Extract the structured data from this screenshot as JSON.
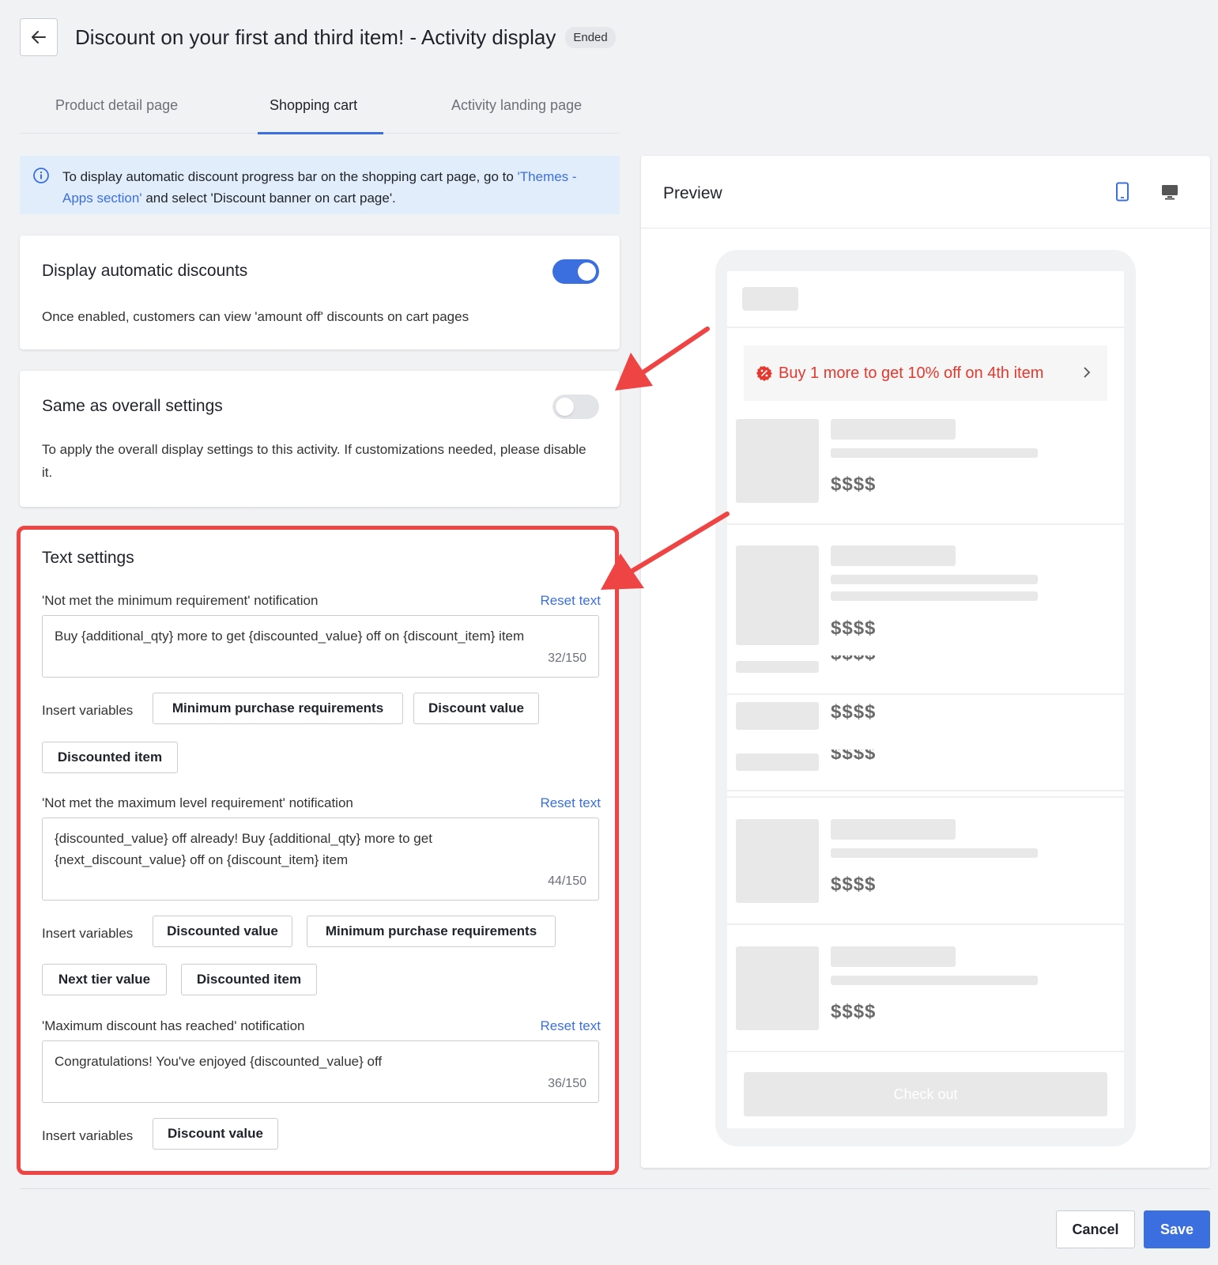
{
  "header": {
    "title": "Discount on your first and third item! - Activity display",
    "status": "Ended"
  },
  "tabs": [
    {
      "label": "Product detail page",
      "active": false
    },
    {
      "label": "Shopping cart",
      "active": true
    },
    {
      "label": "Activity landing page",
      "active": false
    }
  ],
  "info_banner": {
    "text_before": "To display automatic discount progress bar on the shopping cart page, go to ",
    "link": "'Themes - Apps section'",
    "text_after": " and select 'Discount banner on cart page'."
  },
  "display_automatic": {
    "title": "Display automatic discounts",
    "description": "Once enabled, customers can view 'amount off' discounts on cart pages",
    "enabled": true
  },
  "same_as_overall": {
    "title": "Same as overall settings",
    "description": "To apply the overall display settings to this activity. If customizations needed, please disable it.",
    "enabled": false
  },
  "text_settings": {
    "title": "Text settings",
    "reset_label": "Reset text",
    "insert_label": "Insert variables",
    "fields": [
      {
        "label": "'Not met the minimum requirement' notification",
        "value": "Buy  {additional_qty}  more to get {discounted_value} off on {discount_item} item",
        "counter": "32/150",
        "chips": [
          "Minimum purchase requirements",
          "Discount value",
          "Discounted item"
        ]
      },
      {
        "label": "'Not met the maximum level requirement' notification",
        "value": "{discounted_value} off already! Buy {additional_qty} more to get {next_discount_value} off on {discount_item} item",
        "counter": "44/150",
        "chips": [
          "Discounted value",
          "Minimum purchase requirements",
          "Next tier value",
          "Discounted item"
        ]
      },
      {
        "label": "'Maximum discount has reached' notification",
        "value": "Congratulations! You've enjoyed {discounted_value} off",
        "counter": "36/150",
        "chips": [
          "Discount value"
        ]
      }
    ]
  },
  "preview": {
    "title": "Preview",
    "banner_text": "Buy 1 more to get 10% off on 4th item",
    "price": "$$$$",
    "checkout_label": "Check out",
    "accent_red": "#e5382e"
  },
  "footer": {
    "cancel_label": "Cancel",
    "save_label": "Save"
  },
  "colors": {
    "primary": "#3b6fe0",
    "highlight_border": "#ef4444",
    "arrow": "#ef4444"
  }
}
